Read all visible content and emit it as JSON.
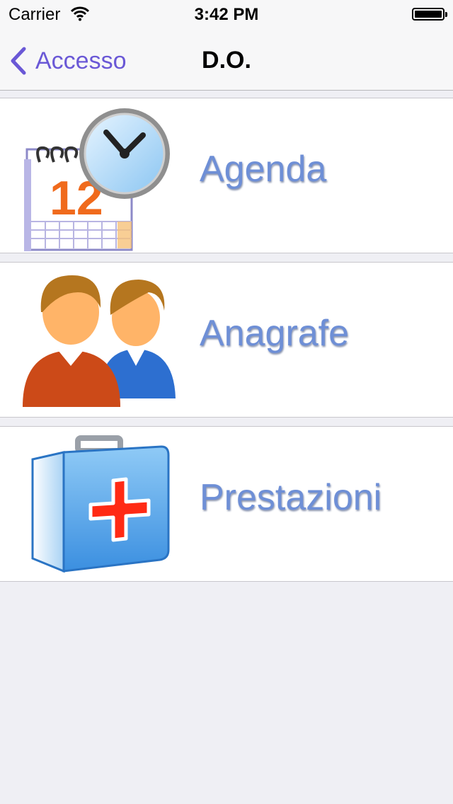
{
  "status_bar": {
    "carrier": "Carrier",
    "time": "3:42 PM"
  },
  "nav": {
    "back_label": "Accesso",
    "title": "D.O."
  },
  "menu": {
    "items": [
      {
        "label": "Agenda",
        "icon": "calendar-clock-icon"
      },
      {
        "label": "Anagrafe",
        "icon": "people-icon"
      },
      {
        "label": "Prestazioni",
        "icon": "first-aid-kit-icon"
      }
    ]
  },
  "colors": {
    "accent": "#6a58d6",
    "label": "#6e8fd6",
    "background": "#efeff4"
  }
}
